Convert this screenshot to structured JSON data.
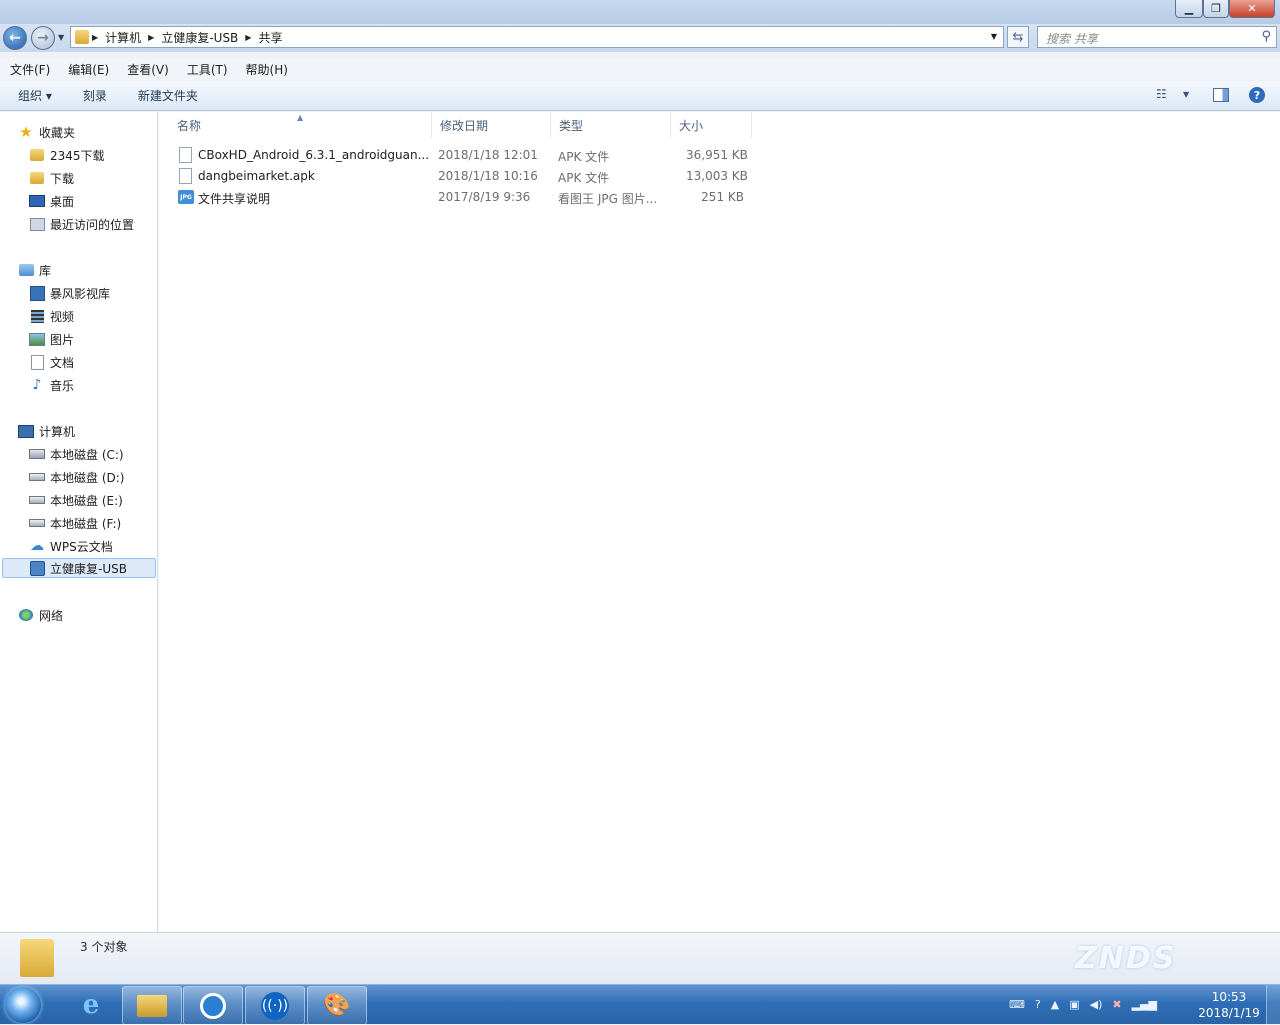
{
  "window": {
    "title": "",
    "minimize_glyph": "▁",
    "maximize_glyph": "❐",
    "close_glyph": "✕"
  },
  "address": {
    "crumbs": [
      "计算机",
      "立健康复-USB",
      "共享"
    ],
    "search_placeholder": "搜索 共享"
  },
  "menu": [
    "文件(F)",
    "编辑(E)",
    "查看(V)",
    "工具(T)",
    "帮助(H)"
  ],
  "commands": {
    "organize": "组织 ▾",
    "burn": "刻录",
    "new_folder": "新建文件夹"
  },
  "nav": {
    "favorites": {
      "label": "收藏夹",
      "items": [
        "2345下载",
        "下载",
        "桌面",
        "最近访问的位置"
      ]
    },
    "libraries": {
      "label": "库",
      "items": [
        "暴风影视库",
        "视频",
        "图片",
        "文档",
        "音乐"
      ]
    },
    "computer": {
      "label": "计算机",
      "items": [
        "本地磁盘 (C:)",
        "本地磁盘 (D:)",
        "本地磁盘 (E:)",
        "本地磁盘 (F:)",
        "WPS云文档",
        "立健康复-USB"
      ]
    },
    "network": {
      "label": "网络"
    }
  },
  "columns": [
    "名称",
    "修改日期",
    "类型",
    "大小"
  ],
  "files": [
    {
      "name": "CBoxHD_Android_6.3.1_androidguan...",
      "modified": "2018/1/18 12:01",
      "type": "APK 文件",
      "size": "36,951 KB",
      "icon": "blank-file-icon"
    },
    {
      "name": "dangbeimarket.apk",
      "modified": "2018/1/18 10:16",
      "type": "APK 文件",
      "size": "13,003 KB",
      "icon": "blank-file-icon"
    },
    {
      "name": "文件共享说明",
      "modified": "2017/8/19 9:36",
      "type": "看图王 JPG 图片...",
      "size": "251 KB",
      "icon": "jpg-file-icon"
    }
  ],
  "status": {
    "object_count": "3 个对象",
    "watermark": "ZNDS"
  },
  "taskbar": {
    "time": "10:53",
    "date": "2018/1/19"
  },
  "colors": {
    "selection": "#dce9f8",
    "taskbar": "#2f6fb6"
  }
}
